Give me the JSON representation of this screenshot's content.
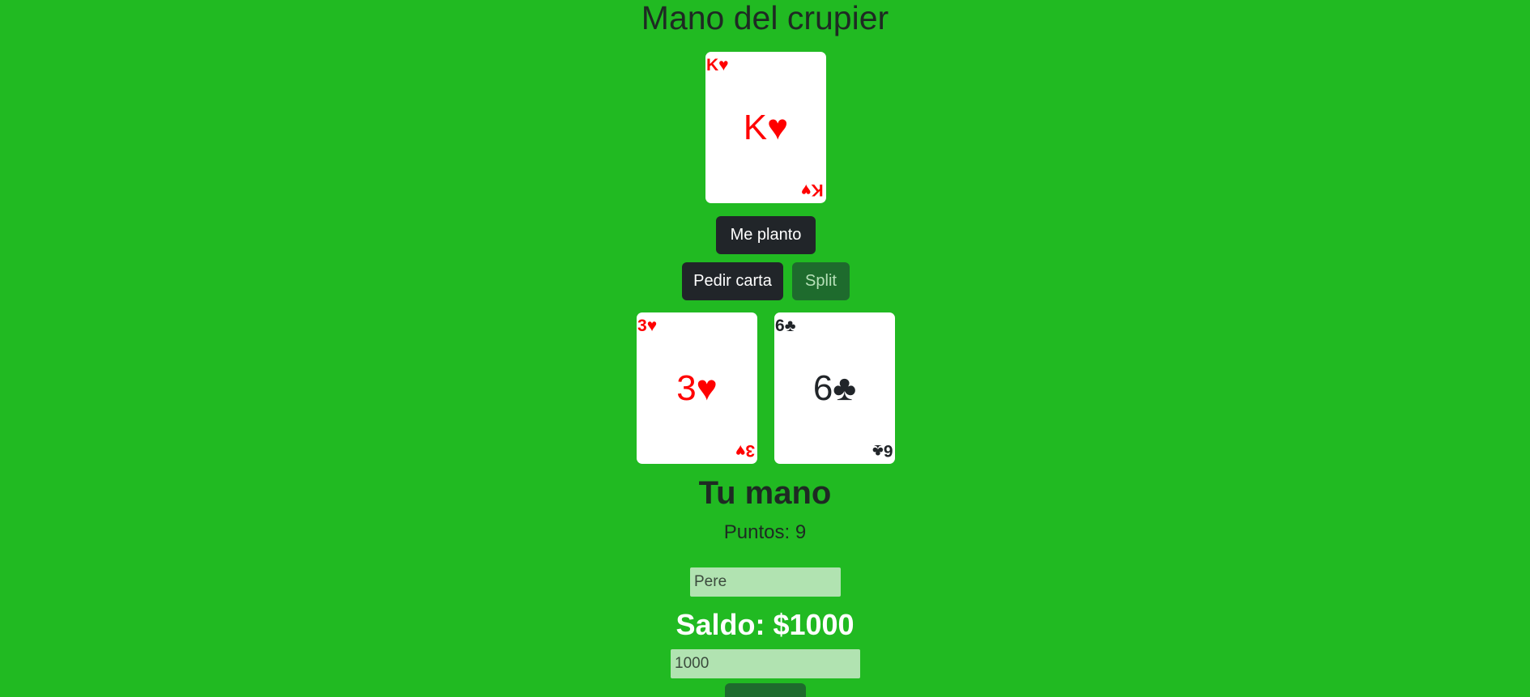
{
  "dealer": {
    "title": "Mano del crupier",
    "cards": [
      {
        "rank": "K",
        "suit": "♥",
        "color": "red"
      }
    ]
  },
  "actions": {
    "stand_label": "Me planto",
    "hit_label": "Pedir carta",
    "split_label": "Split"
  },
  "player": {
    "cards": [
      {
        "rank": "3",
        "suit": "♥",
        "color": "red"
      },
      {
        "rank": "6",
        "suit": "♣",
        "color": "black"
      }
    ],
    "title": "Tu mano",
    "points_text": "Puntos: 9"
  },
  "name_input": {
    "value": "Pere"
  },
  "balance": {
    "text": "Saldo: $1000"
  },
  "bet_input": {
    "value": "1000"
  },
  "colors": {
    "table_green": "#21ba22",
    "dark_button": "#212529",
    "split_button": "#1e6b2d",
    "input_bg": "#b1e3b1",
    "red_suit": "#ff0000"
  }
}
